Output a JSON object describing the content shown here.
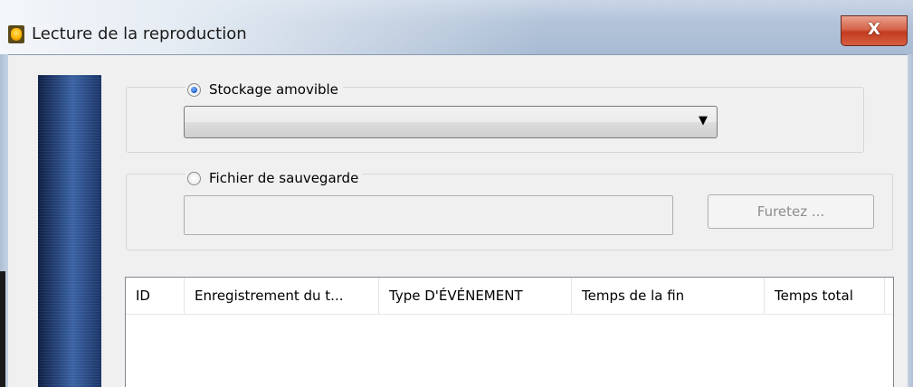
{
  "window": {
    "title": "Lecture de la reproduction",
    "close_glyph": "X",
    "app_icon": "app-shield-icon"
  },
  "removable_storage": {
    "label": "Stockage amovible",
    "selected": true,
    "dropdown_value": ""
  },
  "backup_file": {
    "label": "Fichier de sauvegarde",
    "selected": false,
    "path_value": "",
    "browse_label": "Furetez ...",
    "browse_enabled": false
  },
  "table": {
    "columns": [
      "ID",
      "Enregistrement du t...",
      "Type D'ÉVÉNEMENT",
      "Temps de la fin",
      "Temps total"
    ],
    "rows": []
  },
  "colors": {
    "close_button": "#c83c1f",
    "accent_radio": "#1d5fc7",
    "side_banner": "#2d4f8a"
  }
}
